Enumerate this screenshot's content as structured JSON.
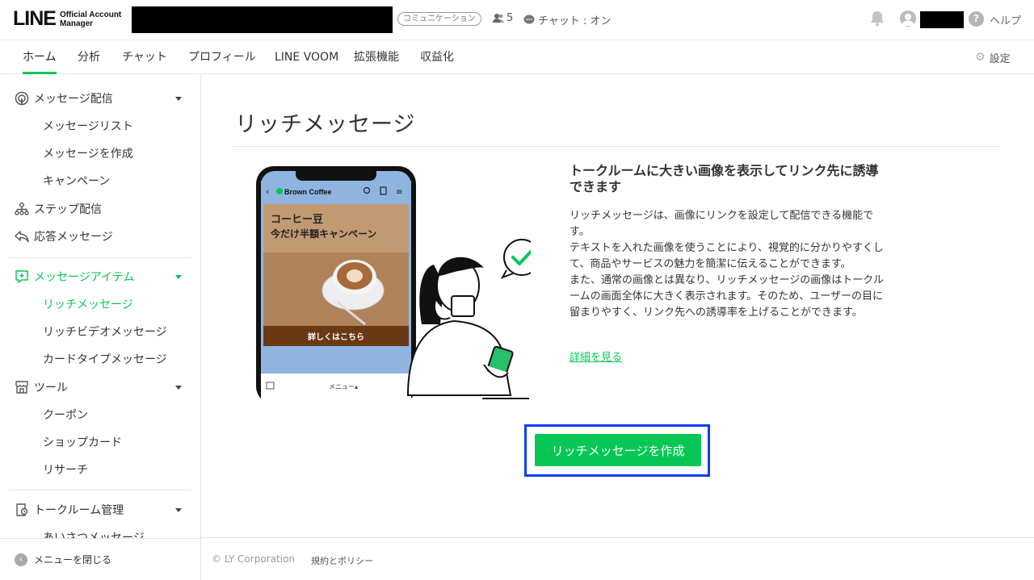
{
  "header": {
    "logo_text": "LINE",
    "logo_sub_line1": "Official Account",
    "logo_sub_line2": "Manager",
    "plan_badge": "コミュニケーション",
    "friend_count": "5",
    "chat_status": "チャット : オン",
    "help_label": "ヘルプ"
  },
  "tabs": [
    {
      "label": "ホーム",
      "active": true
    },
    {
      "label": "分析"
    },
    {
      "label": "チャット"
    },
    {
      "label": "プロフィール"
    },
    {
      "label": "LINE VOOM"
    },
    {
      "label": "拡張機能"
    },
    {
      "label": "収益化"
    }
  ],
  "settings_label": "設定",
  "sidebar": {
    "items": [
      {
        "label": "メッセージ配信",
        "icon": "broadcast-icon",
        "expandable": true
      },
      {
        "label": "メッセージリスト",
        "sub": true
      },
      {
        "label": "メッセージを作成",
        "sub": true
      },
      {
        "label": "キャンペーン",
        "sub": true
      },
      {
        "label": "ステップ配信",
        "icon": "step-icon"
      },
      {
        "label": "応答メッセージ",
        "icon": "reply-icon"
      },
      {
        "label": "メッセージアイテム",
        "icon": "message-item-icon",
        "expandable": true,
        "active": true
      },
      {
        "label": "リッチメッセージ",
        "sub": true,
        "active": true
      },
      {
        "label": "リッチビデオメッセージ",
        "sub": true
      },
      {
        "label": "カードタイプメッセージ",
        "sub": true
      },
      {
        "label": "ツール",
        "icon": "store-icon",
        "expandable": true
      },
      {
        "label": "クーポン",
        "sub": true
      },
      {
        "label": "ショップカード",
        "sub": true
      },
      {
        "label": "リサーチ",
        "sub": true
      },
      {
        "label": "トークルーム管理",
        "icon": "talkroom-icon",
        "expandable": true
      },
      {
        "label": "あいさつメッセージ",
        "sub": true
      }
    ],
    "close_menu": "メニューを閉じる"
  },
  "main": {
    "title": "リッチメッセージ",
    "desc_title": "トークルームに大きい画像を表示してリンク先に誘導できます",
    "desc_body": "リッチメッセージは、画像にリンクを設定して配信できる機能です。\nテキストを入れた画像を使うことにより、視覚的に分かりやすくして、商品やサービスの魅力を簡潔に伝えることができます。\nまた、通常の画像とは異なり、リッチメッセージの画像はトークルームの画面全体に大きく表示されます。そのため、ユーザーの目に留まりやすく、リンク先への誘導率を上げることができます。",
    "detail_link": "詳細を見る",
    "create_button": "リッチメッセージを作成",
    "phone": {
      "chat_name": "Brown Coffee",
      "promo_line1": "コーヒー豆",
      "promo_line2": "今だけ半額キャンペーン",
      "promo_button": "詳しくはこちら",
      "menu_label": "メニュー▴"
    }
  },
  "footer": {
    "copyright": "© LY Corporation",
    "terms": "規約とポリシー"
  },
  "colors": {
    "accent": "#06c755",
    "focus": "#0a3ff0"
  }
}
